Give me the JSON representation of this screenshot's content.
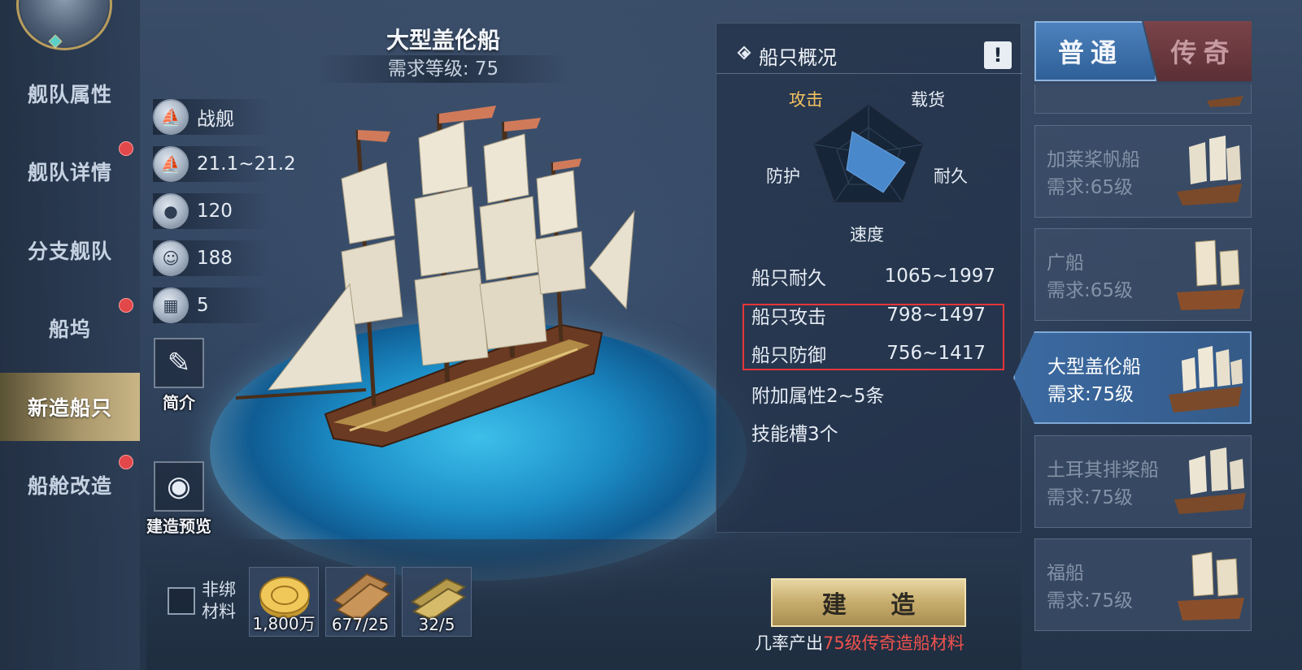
{
  "nav": {
    "items": [
      {
        "label": "舰队属性",
        "dot": false,
        "active": false
      },
      {
        "label": "舰队详情",
        "dot": true,
        "active": false
      },
      {
        "label": "分支舰队",
        "dot": false,
        "active": false
      },
      {
        "label": "船坞",
        "dot": true,
        "active": false
      },
      {
        "label": "新造船只",
        "dot": false,
        "active": true
      },
      {
        "label": "船舱改造",
        "dot": true,
        "active": false
      }
    ]
  },
  "ship": {
    "title": "大型盖伦船",
    "requirement": "需求等级: 75",
    "attributes": [
      {
        "icon": "ship-type-icon",
        "value": "战舰"
      },
      {
        "icon": "sail-speed-icon",
        "value": "21.1~21.2"
      },
      {
        "icon": "supply-icon",
        "value": "120"
      },
      {
        "icon": "crew-icon",
        "value": "188"
      },
      {
        "icon": "cargo-barrel-icon",
        "value": "5"
      }
    ],
    "intro_label": "简介",
    "preview_label": "建造预览"
  },
  "overview": {
    "title": "船只概况",
    "info_button": "!",
    "radar": {
      "labels": {
        "attack": "攻击",
        "cargo": "载货",
        "durability": "耐久",
        "speed": "速度",
        "protection": "防护"
      },
      "highlight": "attack"
    },
    "stats": [
      {
        "label": "船只耐久",
        "value": "1065~1997"
      },
      {
        "label": "船只攻击",
        "value": "798~1497"
      },
      {
        "label": "船只防御",
        "value": "756~1417"
      }
    ],
    "extra_attributes": "附加属性2~5条",
    "skill_slots": "技能槽3个"
  },
  "rarity_tabs": {
    "normal": "普通",
    "legendary": "传奇",
    "active": "normal"
  },
  "ship_list": [
    {
      "name": "加莱桨帆船",
      "req": "需求:65级",
      "active": false
    },
    {
      "name": "广船",
      "req": "需求:65级",
      "active": false
    },
    {
      "name": "大型盖伦船",
      "req": "需求:75级",
      "active": true
    },
    {
      "name": "土耳其排桨船",
      "req": "需求:75级",
      "active": false
    },
    {
      "name": "福船",
      "req": "需求:75级",
      "active": false
    }
  ],
  "materials": {
    "nonbind_label": "非绑材料",
    "items": [
      {
        "icon": "gold-coin-icon",
        "count": "1,800万"
      },
      {
        "icon": "wood-plank-icon",
        "count": "677/25"
      },
      {
        "icon": "metal-ingot-icon",
        "count": "32/5"
      }
    ]
  },
  "build": {
    "label": "建 造",
    "note_prefix": "几率产出",
    "note_highlight": "75级传奇造船材料"
  }
}
